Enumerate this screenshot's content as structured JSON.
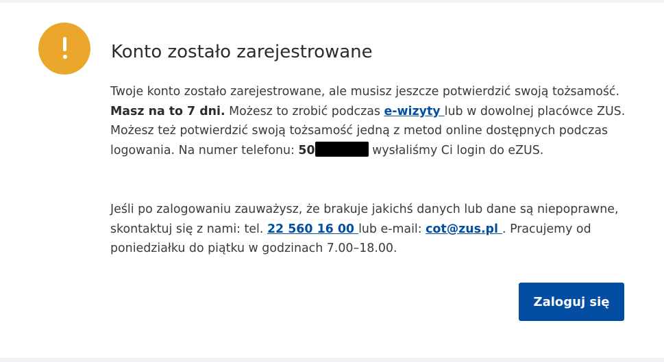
{
  "dialog": {
    "title": "Konto zostało zarejestrowane",
    "icon": "exclamation-icon",
    "icon_color": "#eaa72b",
    "p1": {
      "t1": "Twoje konto zostało zarejestrowane, ale musisz jeszcze potwierdzić swoją tożsamość. ",
      "bold": "Masz na to 7 dni.",
      "t2": " Możesz to zrobić podczas ",
      "link": "e-wizyty ",
      "t3": "lub w dowolnej placówce ZUS. Możesz też potwierdzić swoją tożsamość jedną z metod online dostępnych podczas logowania. Na numer telefonu: ",
      "phone_prefix": "50",
      "t4": " wysłaliśmy Ci login do eZUS."
    },
    "p2": {
      "t1": "Jeśli po zalogowaniu zauważysz, że brakuje jakichś danych lub dane są niepoprawne, skontaktuj się z nami: tel. ",
      "phone": "22 560 16 00 ",
      "t2": "lub e-mail: ",
      "email": "cot@zus.pl ",
      "t3": ". Pracujemy od poniedziałku do piątku w godzinach 7.00–18.00."
    },
    "login_button": "Zaloguj się",
    "accent_color": "#034ea2"
  }
}
